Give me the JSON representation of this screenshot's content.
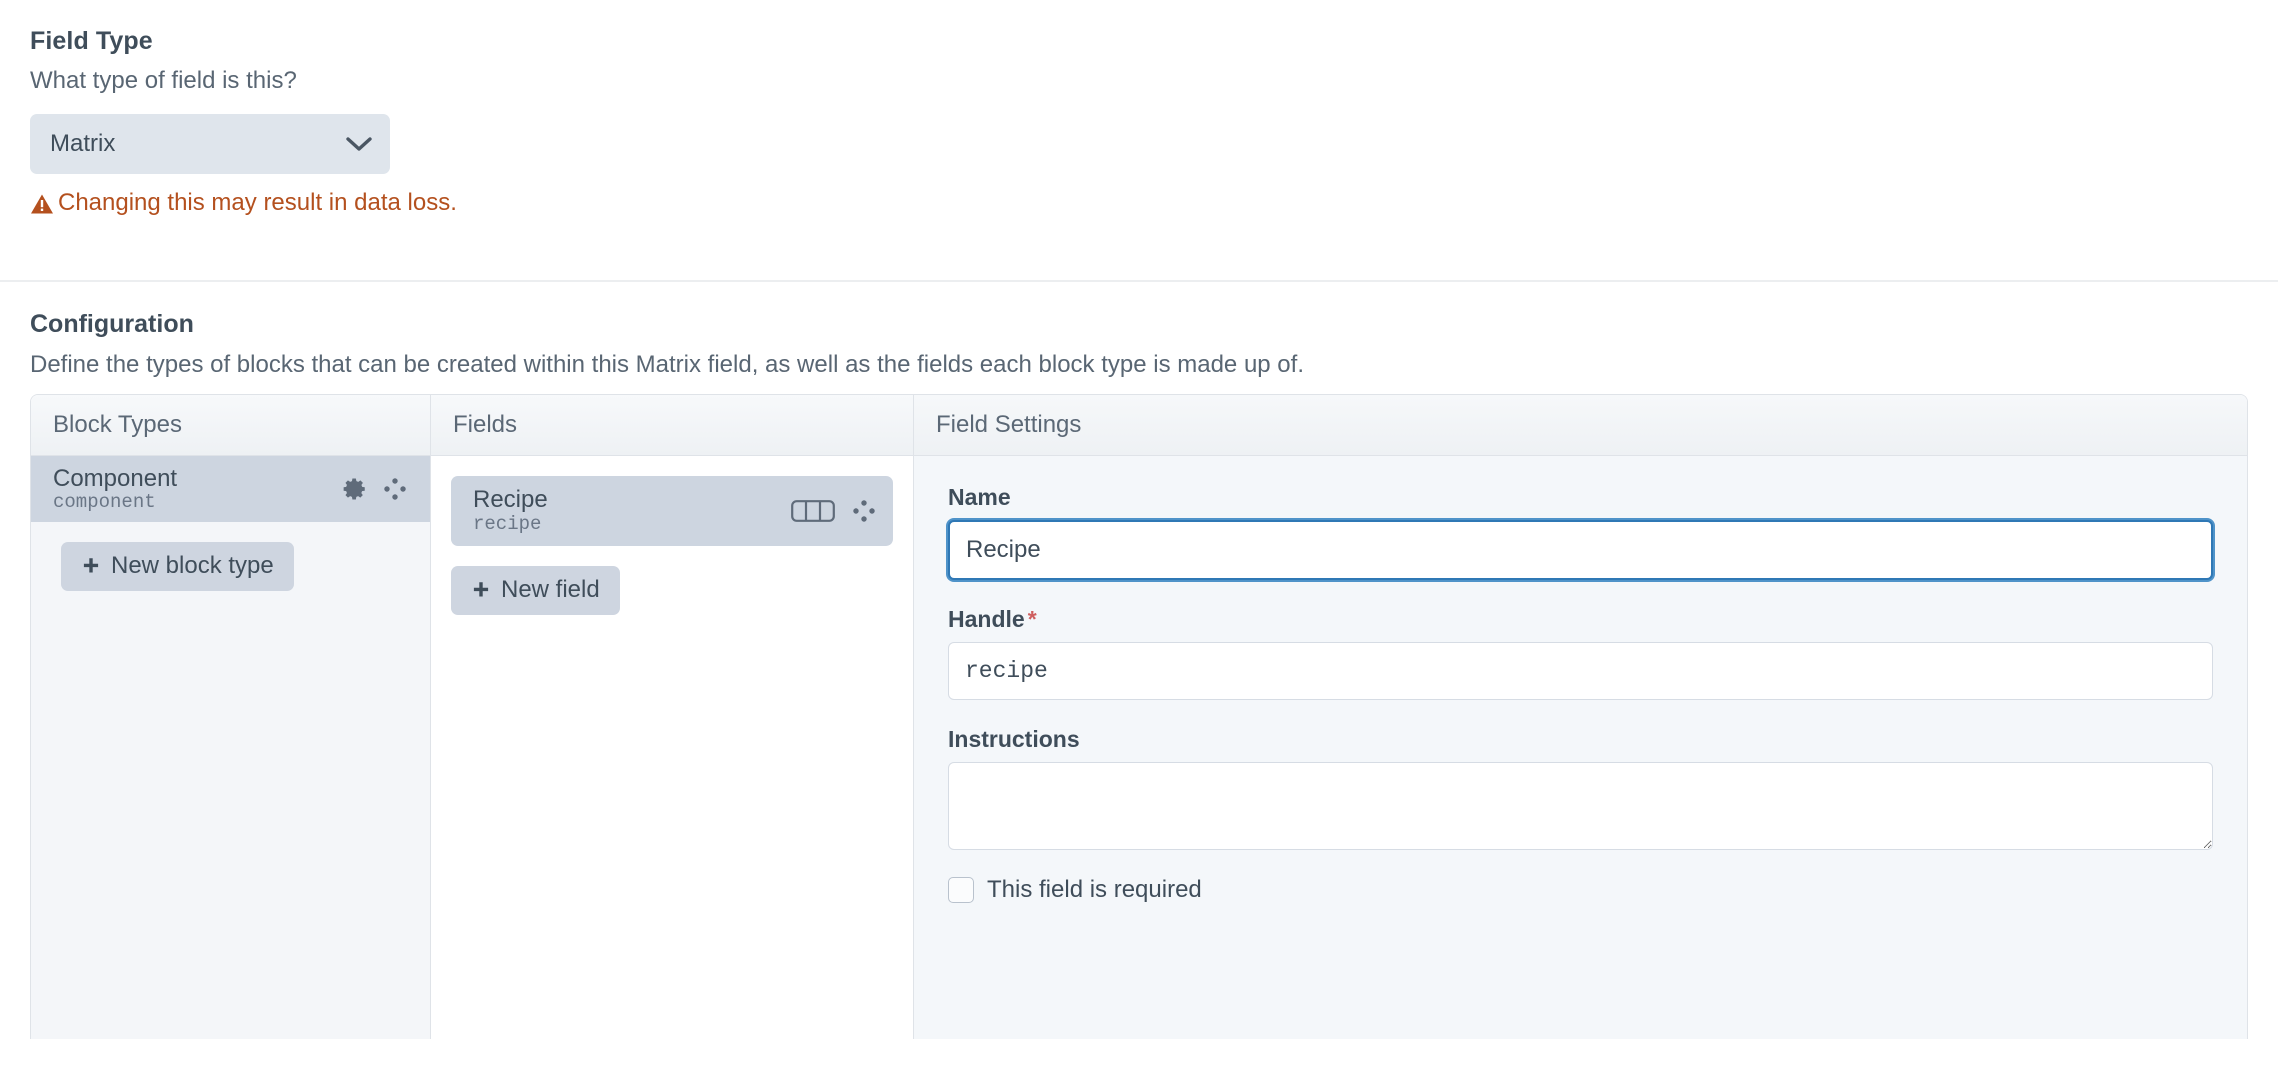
{
  "field_type": {
    "heading": "Field Type",
    "instructions": "What type of field is this?",
    "selected": "Matrix",
    "options": [
      "Matrix"
    ],
    "chevron_icon": "chevron-down-icon",
    "warning_icon": "warning-triangle-icon",
    "warning": "Changing this may result in data loss.",
    "warning_color": "#b4501e"
  },
  "configuration": {
    "heading": "Configuration",
    "description": "Define the types of blocks that can be created within this Matrix field, as well as the fields each block type is made up of.",
    "columns": {
      "block_types": "Block Types",
      "fields": "Fields",
      "field_settings": "Field Settings"
    },
    "block_types": {
      "items": [
        {
          "name": "Component",
          "handle": "component",
          "settings_icon": "gear-icon",
          "move_icon": "move-handle-icon",
          "selected": true
        }
      ],
      "new_button": {
        "icon": "plus-icon",
        "label": "New block type"
      }
    },
    "fields": {
      "items": [
        {
          "name": "Recipe",
          "handle": "recipe",
          "width_icon": "field-width-icon",
          "move_icon": "move-handle-icon",
          "selected": true
        }
      ],
      "new_button": {
        "icon": "plus-icon",
        "label": "New field"
      }
    },
    "field_settings": {
      "name": {
        "label": "Name",
        "value": "Recipe",
        "focused": true
      },
      "handle": {
        "label": "Handle",
        "required_marker": "*",
        "value": "recipe"
      },
      "instructions": {
        "label": "Instructions",
        "value": ""
      },
      "required_checkbox": {
        "label": "This field is required",
        "checked": false
      }
    }
  },
  "colors": {
    "accent_focus": "#2f78b5",
    "warning": "#b4501e",
    "selected_row": "#cdd5e0",
    "panel_bg": "#f4f7fa"
  }
}
